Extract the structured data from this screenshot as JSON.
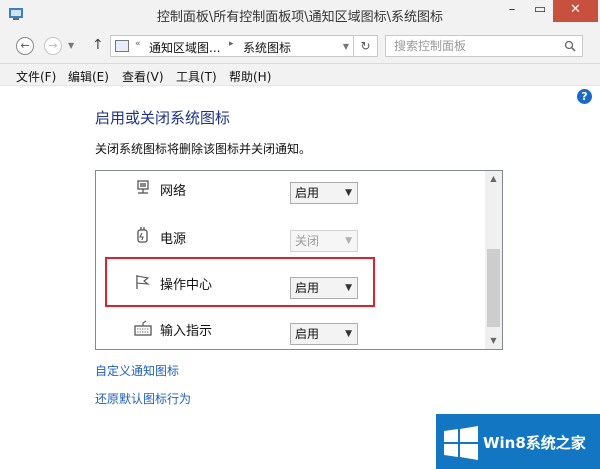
{
  "window": {
    "title": "控制面板\\所有控制面板项\\通知区域图标\\系统图标",
    "min_label": "–",
    "max_label": "▭",
    "close_label": "✕"
  },
  "addressbar": {
    "back_glyph": "←",
    "forward_glyph": "→",
    "up_glyph": "↑",
    "crumb_sep_start": "«",
    "crumb1": "通知区域图...",
    "crumb_sep": "▸",
    "crumb2": "系统图标",
    "refresh_glyph": "↻",
    "search_placeholder": "搜索控制面板"
  },
  "menu": {
    "items": [
      "文件(F)",
      "编辑(E)",
      "查看(V)",
      "工具(T)",
      "帮助(H)"
    ]
  },
  "help_glyph": "?",
  "page": {
    "heading": "启用或关闭系统图标",
    "description": "关闭系统图标将删除该图标并关闭通知。"
  },
  "icons": {
    "rows": [
      {
        "label": "网络",
        "value": "启用",
        "enabled": true,
        "icon": "network-icon"
      },
      {
        "label": "电源",
        "value": "关闭",
        "enabled": false,
        "icon": "power-icon"
      },
      {
        "label": "操作中心",
        "value": "启用",
        "enabled": true,
        "icon": "flag-icon"
      },
      {
        "label": "输入指示",
        "value": "启用",
        "enabled": true,
        "icon": "keyboard-icon"
      }
    ]
  },
  "scroll": {
    "up": "▲",
    "down": "▼"
  },
  "links": {
    "customize": "自定义通知图标",
    "restore": "还原默认图标行为"
  },
  "watermark": {
    "text": "Win8系统之家"
  },
  "colors": {
    "heading": "#1e3287",
    "link": "#1e5fc0",
    "highlight": "#e0202c",
    "watermark_bg": "#1376c2"
  }
}
